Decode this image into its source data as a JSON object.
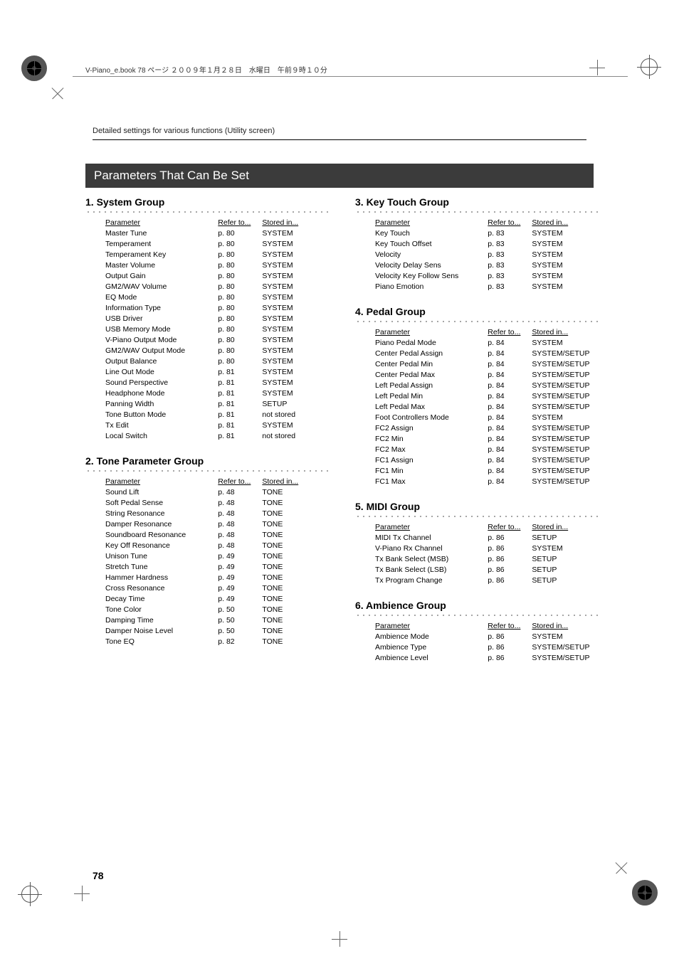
{
  "running_head": "V-Piano_e.book  78 ページ  ２００９年１月２８日　水曜日　午前９時１０分",
  "section_head": "Detailed settings for various functions (Utility screen)",
  "bar_heading": "Parameters That Can Be Set",
  "page_number": "78",
  "col_headers": {
    "parameter": "Parameter",
    "refer_to": "Refer to...",
    "stored_in": "Stored in..."
  },
  "groups": [
    {
      "id": "system",
      "title": "1. System Group",
      "column": 0,
      "chart_data": {
        "type": "table",
        "columns": [
          "Parameter",
          "Refer to...",
          "Stored in..."
        ],
        "rows": [
          [
            "Master Tune",
            "p. 80",
            "SYSTEM"
          ],
          [
            "Temperament",
            "p. 80",
            "SYSTEM"
          ],
          [
            "Temperament Key",
            "p. 80",
            "SYSTEM"
          ],
          [
            "Master Volume",
            "p. 80",
            "SYSTEM"
          ],
          [
            "Output Gain",
            "p. 80",
            "SYSTEM"
          ],
          [
            "GM2/WAV Volume",
            "p. 80",
            "SYSTEM"
          ],
          [
            "EQ Mode",
            "p. 80",
            "SYSTEM"
          ],
          [
            "Information Type",
            "p. 80",
            "SYSTEM"
          ],
          [
            "USB Driver",
            "p. 80",
            "SYSTEM"
          ],
          [
            "USB Memory Mode",
            "p. 80",
            "SYSTEM"
          ],
          [
            "V-Piano Output Mode",
            "p. 80",
            "SYSTEM"
          ],
          [
            "GM2/WAV Output Mode",
            "p. 80",
            "SYSTEM"
          ],
          [
            "Output Balance",
            "p. 80",
            "SYSTEM"
          ],
          [
            "Line Out Mode",
            "p. 81",
            "SYSTEM"
          ],
          [
            "Sound Perspective",
            "p. 81",
            "SYSTEM"
          ],
          [
            "Headphone Mode",
            "p. 81",
            "SYSTEM"
          ],
          [
            "Panning Width",
            "p. 81",
            "SETUP"
          ],
          [
            "Tone Button Mode",
            "p. 81",
            "not stored"
          ],
          [
            "Tx Edit",
            "p. 81",
            "SYSTEM"
          ],
          [
            "Local Switch",
            "p. 81",
            "not stored"
          ]
        ]
      }
    },
    {
      "id": "tone",
      "title": "2. Tone Parameter Group",
      "column": 0,
      "chart_data": {
        "type": "table",
        "columns": [
          "Parameter",
          "Refer to...",
          "Stored in..."
        ],
        "rows": [
          [
            "Sound Lift",
            "p. 48",
            "TONE"
          ],
          [
            "Soft Pedal Sense",
            "p. 48",
            "TONE"
          ],
          [
            "String Resonance",
            "p. 48",
            "TONE"
          ],
          [
            "Damper Resonance",
            "p. 48",
            "TONE"
          ],
          [
            "Soundboard Resonance",
            "p. 48",
            "TONE"
          ],
          [
            "Key Off Resonance",
            "p. 48",
            "TONE"
          ],
          [
            "Unison Tune",
            "p. 49",
            "TONE"
          ],
          [
            "Stretch Tune",
            "p. 49",
            "TONE"
          ],
          [
            "Hammer Hardness",
            "p. 49",
            "TONE"
          ],
          [
            "Cross Resonance",
            "p. 49",
            "TONE"
          ],
          [
            "Decay Time",
            "p. 49",
            "TONE"
          ],
          [
            "Tone Color",
            "p. 50",
            "TONE"
          ],
          [
            "Damping Time",
            "p. 50",
            "TONE"
          ],
          [
            "Damper Noise Level",
            "p. 50",
            "TONE"
          ],
          [
            "Tone EQ",
            "p. 82",
            "TONE"
          ]
        ]
      }
    },
    {
      "id": "keytouch",
      "title": "3. Key Touch Group",
      "column": 1,
      "chart_data": {
        "type": "table",
        "columns": [
          "Parameter",
          "Refer to...",
          "Stored in..."
        ],
        "rows": [
          [
            "Key Touch",
            "p. 83",
            "SYSTEM"
          ],
          [
            "Key Touch Offset",
            "p. 83",
            "SYSTEM"
          ],
          [
            "Velocity",
            "p. 83",
            "SYSTEM"
          ],
          [
            "Velocity Delay Sens",
            "p. 83",
            "SYSTEM"
          ],
          [
            "Velocity Key Follow Sens",
            "p. 83",
            "SYSTEM"
          ],
          [
            "Piano Emotion",
            "p. 83",
            "SYSTEM"
          ]
        ]
      }
    },
    {
      "id": "pedal",
      "title": "4. Pedal Group",
      "column": 1,
      "chart_data": {
        "type": "table",
        "columns": [
          "Parameter",
          "Refer to...",
          "Stored in..."
        ],
        "rows": [
          [
            "Piano Pedal Mode",
            "p. 84",
            "SYSTEM"
          ],
          [
            "Center Pedal Assign",
            "p. 84",
            "SYSTEM/SETUP"
          ],
          [
            "Center Pedal Min",
            "p. 84",
            "SYSTEM/SETUP"
          ],
          [
            "Center Pedal Max",
            "p. 84",
            "SYSTEM/SETUP"
          ],
          [
            "Left Pedal Assign",
            "p. 84",
            "SYSTEM/SETUP"
          ],
          [
            "Left Pedal Min",
            "p. 84",
            "SYSTEM/SETUP"
          ],
          [
            "Left Pedal Max",
            "p. 84",
            "SYSTEM/SETUP"
          ],
          [
            "Foot Controllers Mode",
            "p. 84",
            "SYSTEM"
          ],
          [
            "FC2 Assign",
            "p. 84",
            "SYSTEM/SETUP"
          ],
          [
            "FC2 Min",
            "p. 84",
            "SYSTEM/SETUP"
          ],
          [
            "FC2 Max",
            "p. 84",
            "SYSTEM/SETUP"
          ],
          [
            "FC1 Assign",
            "p. 84",
            "SYSTEM/SETUP"
          ],
          [
            "FC1 Min",
            "p. 84",
            "SYSTEM/SETUP"
          ],
          [
            "FC1 Max",
            "p. 84",
            "SYSTEM/SETUP"
          ]
        ]
      }
    },
    {
      "id": "midi",
      "title": "5. MIDI Group",
      "column": 1,
      "chart_data": {
        "type": "table",
        "columns": [
          "Parameter",
          "Refer to...",
          "Stored in..."
        ],
        "rows": [
          [
            "MIDI Tx Channel",
            "p. 86",
            "SETUP"
          ],
          [
            "V-Piano Rx Channel",
            "p. 86",
            "SYSTEM"
          ],
          [
            "Tx Bank Select (MSB)",
            "p. 86",
            "SETUP"
          ],
          [
            "Tx Bank Select (LSB)",
            "p. 86",
            "SETUP"
          ],
          [
            "Tx Program Change",
            "p. 86",
            "SETUP"
          ]
        ]
      }
    },
    {
      "id": "ambience",
      "title": "6. Ambience Group",
      "column": 1,
      "chart_data": {
        "type": "table",
        "columns": [
          "Parameter",
          "Refer to...",
          "Stored in..."
        ],
        "rows": [
          [
            "Ambience Mode",
            "p. 86",
            "SYSTEM"
          ],
          [
            "Ambience Type",
            "p. 86",
            "SYSTEM/SETUP"
          ],
          [
            "Ambience Level",
            "p. 86",
            "SYSTEM/SETUP"
          ]
        ]
      }
    }
  ]
}
